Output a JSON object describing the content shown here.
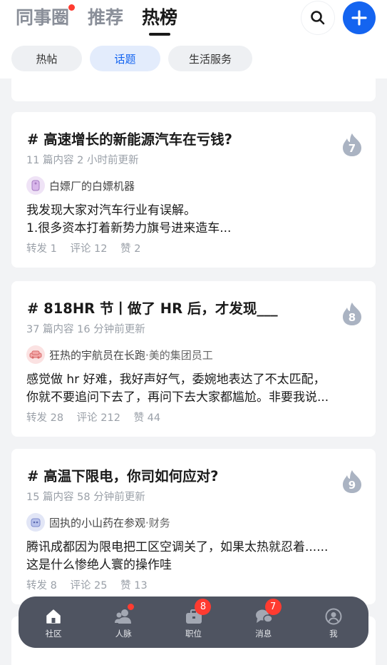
{
  "header": {
    "tabs": [
      {
        "label": "同事圈",
        "active": false,
        "dot": true
      },
      {
        "label": "推荐",
        "active": false,
        "dot": false
      },
      {
        "label": "热榜",
        "active": true,
        "dot": false
      }
    ],
    "search_icon": "search-icon",
    "add_icon": "plus-icon",
    "accent": "#1464f0"
  },
  "chips": [
    {
      "label": "热帖",
      "active": false
    },
    {
      "label": "话题",
      "active": true
    },
    {
      "label": "生活服务",
      "active": false
    }
  ],
  "cards": [
    {
      "title": "# 高速增长的新能源汽车在亏钱?",
      "meta": "11 篇内容  2 小时前更新",
      "author": "白嫖厂的白嫖机器",
      "company": "",
      "body_lines": [
        "我发现大家对汽车行业有误解。",
        "1.很多资本打着新势力旗号进来造车..."
      ],
      "stats": [
        "转发 1",
        "评论 12",
        "赞 2"
      ],
      "rank": "7"
    },
    {
      "title": "# 818HR 节丨做了 HR 后，才发现___",
      "meta": "37 篇内容  16 分钟前更新",
      "author": "狂热的宇航员在长跑",
      "company": "·美的集团员工",
      "body_lines": [
        "感觉做 hr 好难，我好声好气，委婉地表达了不太匹配，",
        "你就不要追问下去了，再问下去大家都尴尬。非要我说..."
      ],
      "stats": [
        "转发 28",
        "评论 212",
        "赞 44"
      ],
      "rank": "8"
    },
    {
      "title": "# 高温下限电，你司如何应对?",
      "meta": "15 篇内容  58 分钟前更新",
      "author": "固执的小山药在参观",
      "company": "·财务",
      "body_lines": [
        "腾讯成都因为限电把工区空调关了，如果太热就忍着......",
        "这是什么惨绝人寰的操作哇"
      ],
      "stats": [
        "转发 8",
        "评论 25",
        "赞 13"
      ],
      "rank": "9"
    }
  ],
  "tabbar": {
    "items": [
      {
        "label": "社区",
        "icon": "home-icon",
        "badge": "",
        "dot": false
      },
      {
        "label": "人脉",
        "icon": "contacts-icon",
        "badge": "",
        "dot": true
      },
      {
        "label": "职位",
        "icon": "briefcase-icon",
        "badge": "8",
        "dot": false
      },
      {
        "label": "消息",
        "icon": "chat-icon",
        "badge": "7",
        "dot": false
      },
      {
        "label": "我",
        "icon": "profile-icon",
        "badge": "",
        "dot": false
      }
    ]
  }
}
